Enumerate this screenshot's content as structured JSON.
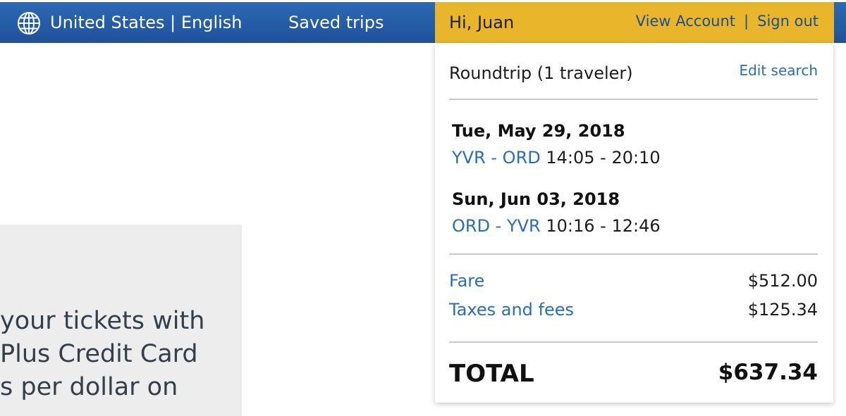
{
  "header": {
    "locale": "United States | English",
    "saved_trips": "Saved trips",
    "greeting": "Hi, Juan",
    "view_account": "View Account",
    "separator": "|",
    "sign_out": "Sign out",
    "icon": "globe-icon",
    "colors": {
      "nav": "#2463aa",
      "greeting_bar": "#e9b52b",
      "link": "#2a6fb3"
    }
  },
  "promo": {
    "lines": [
      "your tickets with",
      "Plus Credit Card",
      "s per dollar on"
    ]
  },
  "summary": {
    "trip_type": "Roundtrip (1 traveler)",
    "edit_search": "Edit search",
    "legs": [
      {
        "date": "Tue, May 29, 2018",
        "route": "YVR - ORD",
        "times": "14:05 - 20:10"
      },
      {
        "date": "Sun, Jun 03, 2018",
        "route": "ORD - YVR",
        "times": "10:16 - 12:46"
      }
    ],
    "fare": {
      "label": "Fare",
      "value": "$512.00"
    },
    "taxes": {
      "label": "Taxes and fees",
      "value": "$125.34"
    },
    "total": {
      "label": "TOTAL",
      "value": "$637.34"
    }
  }
}
